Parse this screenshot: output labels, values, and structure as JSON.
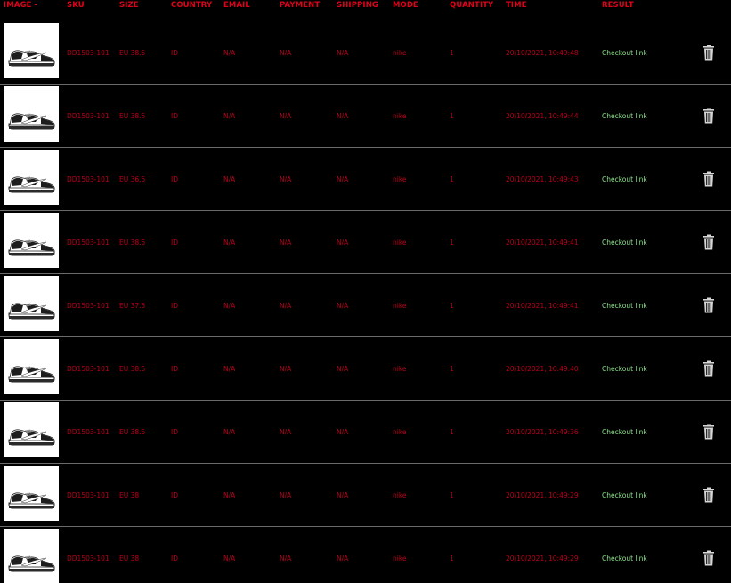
{
  "columns": [
    "IMAGE -",
    "SKU",
    "SIZE",
    "COUNTRY",
    "EMAIL",
    "PAYMENT",
    "SHIPPING",
    "MODE",
    "QUANTITY",
    "TIME",
    "RESULT"
  ],
  "icons": {
    "product_image": "sneaker-thumbnail-icon",
    "delete": "trash-icon"
  },
  "colors": {
    "header": "#e0001a",
    "cell": "#b8001a",
    "result": "#8fe58f",
    "background": "#000000",
    "divider": "#6a6a6a"
  },
  "rows": [
    {
      "sku": "DD1503-101",
      "size": "EU 38.5",
      "country": "ID",
      "email": "N/A",
      "payment": "N/A",
      "shipping": "N/A",
      "mode": "nike",
      "quantity": "1",
      "time": "20/10/2021, 10:49:48",
      "result": "Checkout link"
    },
    {
      "sku": "DD1503-101",
      "size": "EU 38.5",
      "country": "ID",
      "email": "N/A",
      "payment": "N/A",
      "shipping": "N/A",
      "mode": "nike",
      "quantity": "1",
      "time": "20/10/2021, 10:49:44",
      "result": "Checkout link"
    },
    {
      "sku": "DD1503-101",
      "size": "EU 36.5",
      "country": "ID",
      "email": "N/A",
      "payment": "N/A",
      "shipping": "N/A",
      "mode": "nike",
      "quantity": "1",
      "time": "20/10/2021, 10:49:43",
      "result": "Checkout link"
    },
    {
      "sku": "DD1503-101",
      "size": "EU 38.5",
      "country": "ID",
      "email": "N/A",
      "payment": "N/A",
      "shipping": "N/A",
      "mode": "nike",
      "quantity": "1",
      "time": "20/10/2021, 10:49:41",
      "result": "Checkout link"
    },
    {
      "sku": "DD1503-101",
      "size": "EU 37.5",
      "country": "ID",
      "email": "N/A",
      "payment": "N/A",
      "shipping": "N/A",
      "mode": "nike",
      "quantity": "1",
      "time": "20/10/2021, 10:49:41",
      "result": "Checkout link"
    },
    {
      "sku": "DD1503-101",
      "size": "EU 38.5",
      "country": "ID",
      "email": "N/A",
      "payment": "N/A",
      "shipping": "N/A",
      "mode": "nike",
      "quantity": "1",
      "time": "20/10/2021, 10:49:40",
      "result": "Checkout link"
    },
    {
      "sku": "DD1503-101",
      "size": "EU 38.5",
      "country": "ID",
      "email": "N/A",
      "payment": "N/A",
      "shipping": "N/A",
      "mode": "nike",
      "quantity": "1",
      "time": "20/10/2021, 10:49:36",
      "result": "Checkout link"
    },
    {
      "sku": "DD1503-101",
      "size": "EU 38",
      "country": "ID",
      "email": "N/A",
      "payment": "N/A",
      "shipping": "N/A",
      "mode": "nike",
      "quantity": "1",
      "time": "20/10/2021, 10:49:29",
      "result": "Checkout link"
    },
    {
      "sku": "DD1503-101",
      "size": "EU 38",
      "country": "ID",
      "email": "N/A",
      "payment": "N/A",
      "shipping": "N/A",
      "mode": "nike",
      "quantity": "1",
      "time": "20/10/2021, 10:49:29",
      "result": "Checkout link"
    }
  ]
}
